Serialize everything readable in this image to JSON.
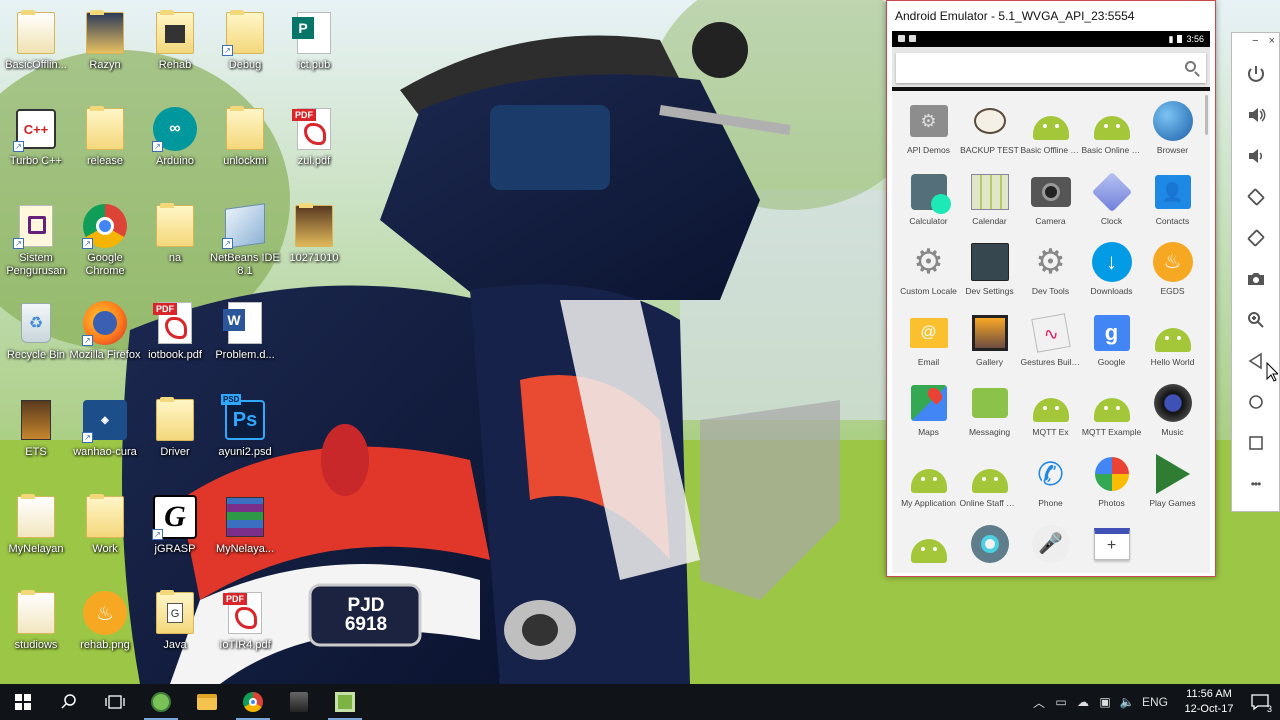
{
  "desktop": {
    "icons": [
      {
        "label": "BasicOfflin..."
      },
      {
        "label": "Razyn"
      },
      {
        "label": "Rehab"
      },
      {
        "label": "Debug"
      },
      {
        "label": "ict.pub"
      },
      {
        "label": "Turbo C++"
      },
      {
        "label": "release"
      },
      {
        "label": "Arduino"
      },
      {
        "label": "unlockmi"
      },
      {
        "label": "zul.pdf"
      },
      {
        "label": "Sistem Pengurusan"
      },
      {
        "label": "Google Chrome"
      },
      {
        "label": "na"
      },
      {
        "label": "NetBeans IDE 8.1"
      },
      {
        "label": "10271010"
      },
      {
        "label": "Recycle Bin"
      },
      {
        "label": "Mozilla Firefox"
      },
      {
        "label": "iotbook.pdf"
      },
      {
        "label": "Problem.d..."
      },
      {
        "label": "ETS"
      },
      {
        "label": "wanhao-cura"
      },
      {
        "label": "Driver"
      },
      {
        "label": "ayuni2.psd"
      },
      {
        "label": "MyNelayan"
      },
      {
        "label": "Work"
      },
      {
        "label": "jGRASP"
      },
      {
        "label": "MyNelaya..."
      },
      {
        "label": "studiows"
      },
      {
        "label": "rehab.png"
      },
      {
        "label": "Java"
      },
      {
        "label": "IoTIR4.pdf"
      }
    ],
    "badges": {
      "pdf": "PDF",
      "psd": "PSD",
      "ps": "Ps",
      "grasp": "G",
      "word": "W",
      "java": "G"
    },
    "license_plate": {
      "line1": "PJD",
      "line2": "6918"
    }
  },
  "emulator": {
    "title": "Android Emulator - 5.1_WVGA_API_23:5554",
    "status_time": "3:56",
    "apps": [
      {
        "label": "API Demos"
      },
      {
        "label": "BACKUP TEST"
      },
      {
        "label": "Basic Offline D..."
      },
      {
        "label": "Basic Online D..."
      },
      {
        "label": "Browser"
      },
      {
        "label": "Calculator"
      },
      {
        "label": "Calendar"
      },
      {
        "label": "Camera"
      },
      {
        "label": "Clock"
      },
      {
        "label": "Contacts"
      },
      {
        "label": "Custom Locale"
      },
      {
        "label": "Dev Settings"
      },
      {
        "label": "Dev Tools"
      },
      {
        "label": "Downloads"
      },
      {
        "label": "EGDS"
      },
      {
        "label": "Email"
      },
      {
        "label": "Gallery"
      },
      {
        "label": "Gestures Build..."
      },
      {
        "label": "Google"
      },
      {
        "label": "Hello World"
      },
      {
        "label": "Maps"
      },
      {
        "label": "Messaging"
      },
      {
        "label": "MQTT Ex"
      },
      {
        "label": "MQTT Example"
      },
      {
        "label": "Music"
      },
      {
        "label": "My Application"
      },
      {
        "label": "Online Staff M..."
      },
      {
        "label": "Phone"
      },
      {
        "label": "Photos"
      },
      {
        "label": "Play Games"
      },
      {
        "label": ""
      },
      {
        "label": ""
      },
      {
        "label": ""
      },
      {
        "label": ""
      }
    ],
    "icon_glyphs": {
      "google": "g",
      "plus": "+",
      "email": "@"
    },
    "toolbar": {
      "minimize": "−",
      "close": "×",
      "more": "•••"
    }
  },
  "taskbar": {
    "language": "ENG",
    "time": "11:56 AM",
    "date": "12-Oct-17",
    "notification_count": "3"
  },
  "colors": {
    "taskbar": "#101418",
    "android_green": "#a4c639",
    "emulator_border": "#c84a4a"
  }
}
